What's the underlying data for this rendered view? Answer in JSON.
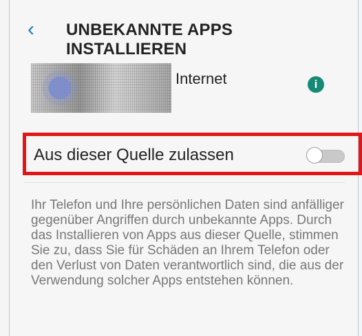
{
  "screen": {
    "title": "UNBEKANNTE APPS INSTALLIEREN",
    "back_icon": "‹"
  },
  "app": {
    "name": "Internet",
    "info_icon": "i"
  },
  "setting": {
    "label": "Aus dieser Quelle zulassen",
    "enabled": false
  },
  "description": "Ihr Telefon und Ihre persönlichen Daten sind anfälliger gegenüber Angriffen durch unbekannte Apps. Durch das Installieren von Apps aus dieser Quelle, stimmen Sie zu, dass Sie für Schäden an Ihrem Telefon oder den Verlust von Daten verantwortlich sind, die aus der Verwendung solcher Apps entstehen können.",
  "colors": {
    "accent": "#1f7db8",
    "info": "#168a74",
    "highlight": "#e11616"
  }
}
